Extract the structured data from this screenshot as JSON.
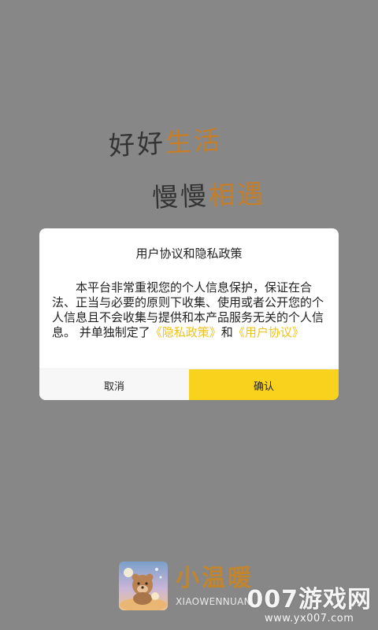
{
  "splash": {
    "slogan_line1": {
      "dark": "好好",
      "accent": "生活"
    },
    "slogan_line2": {
      "dark": "慢慢",
      "accent": "相遇"
    },
    "app_name": "小温暖",
    "app_name_latin": "XIAOWENNUAN"
  },
  "dialog": {
    "title": "用户协议和隐私政策",
    "body_text": "本平台非常重视您的个人信息保护，保证在合法、正当与必要的原则下收集、使用或者公开您的个人信息且不会收集与提供和本产品服务无关的个人信息。 并单独制定了",
    "privacy_link": "《隐私政策》",
    "connector": "和",
    "user_agreement_link": "《用户协议》",
    "cancel_label": "取消",
    "confirm_label": "确认"
  },
  "watermark": {
    "main": "007游戏网",
    "sub": "www.yx007.com"
  },
  "colors": {
    "backdrop": "#878787",
    "accent_gold": "#c47e2a",
    "link_yellow": "#f2c219",
    "confirm_button": "#f9d21d",
    "cancel_button": "#f7f7f7"
  }
}
